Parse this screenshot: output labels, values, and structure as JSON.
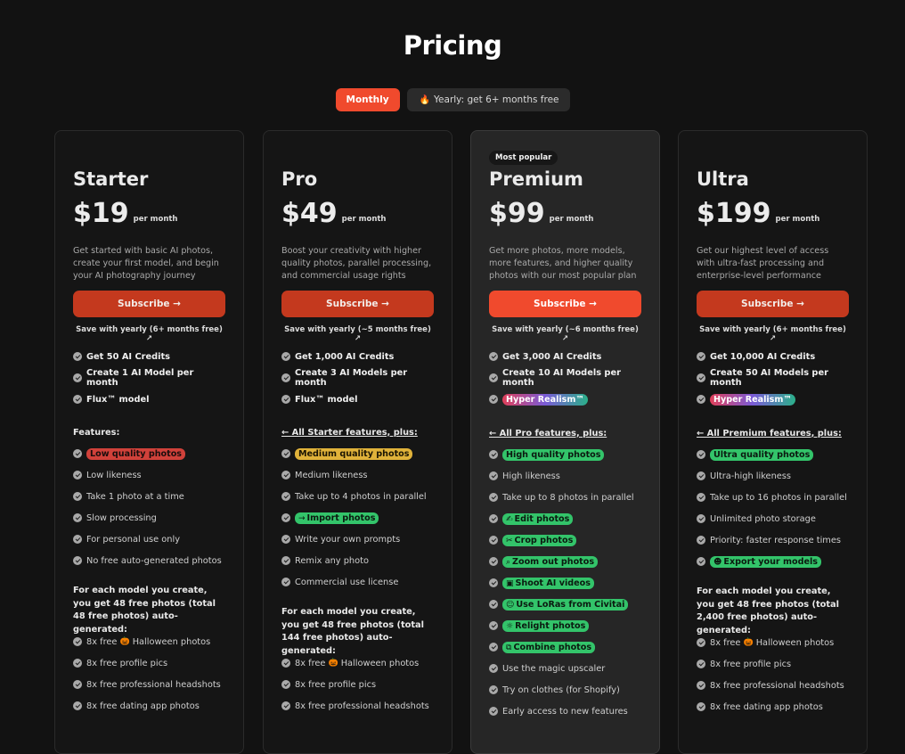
{
  "page": {
    "title": "Pricing",
    "toggle": {
      "monthly": "Monthly",
      "yearly_icon": "flame-icon",
      "yearly": "Yearly: get 6+ months free"
    }
  },
  "colors": {
    "accent": "#f04a2d",
    "accent_dark": "#c4391e",
    "background": "#121212",
    "pill_red": "#d0413a",
    "pill_yellow": "#e0b23a",
    "pill_green": "#33c46a"
  },
  "plans": [
    {
      "name": "Starter",
      "price": "$19",
      "period": "per month",
      "description": "Get started with basic AI photos, create your first model, and begin your AI photography journey",
      "cta": "Subscribe →",
      "save": "Save with yearly (6+ months free) ↗",
      "highlights": [
        "Get 50 AI Credits",
        "Create 1 AI Model per month",
        "Flux™ model"
      ],
      "features_title": "Features:",
      "features": [
        {
          "text": "Low quality photos",
          "pill": "red"
        },
        {
          "text": "Low likeness"
        },
        {
          "text": "Take 1 photo at a time"
        },
        {
          "text": "Slow processing"
        },
        {
          "text": "For personal use only"
        },
        {
          "text": "No free auto-generated photos"
        }
      ],
      "models_text": "For each model you create, you get 48 free photos (total 48 free photos) auto-generated:",
      "extras": [
        {
          "pre": "8x free",
          "icon": "pumpkin-icon",
          "post": "Halloween photos"
        },
        {
          "pre": "8x free profile pics"
        },
        {
          "pre": "8x free professional headshots"
        },
        {
          "pre": "8x free dating app photos"
        }
      ]
    },
    {
      "name": "Pro",
      "price": "$49",
      "period": "per month",
      "description": "Boost your creativity with higher quality photos, parallel processing, and commercial usage rights",
      "cta": "Subscribe →",
      "save": "Save with yearly (~5 months free) ↗",
      "highlights": [
        "Get 1,000 AI Credits",
        "Create 3 AI Models per month",
        "Flux™ model"
      ],
      "features_title": "← All Starter features, plus:",
      "features": [
        {
          "text": "Medium quality photos",
          "pill": "yellow"
        },
        {
          "text": "Medium likeness"
        },
        {
          "text": "Take up to 4 photos in parallel"
        },
        {
          "text": "Import photos",
          "pill": "green",
          "icon": "→"
        },
        {
          "text": "Write your own prompts"
        },
        {
          "text": "Remix any photo"
        },
        {
          "text": "Commercial use license"
        }
      ],
      "models_text": "For each model you create, you get 48 free photos (total 144 free photos) auto-generated:",
      "extras": [
        {
          "pre": "8x free",
          "icon": "pumpkin-icon",
          "post": "Halloween photos"
        },
        {
          "pre": "8x free profile pics"
        },
        {
          "pre": "8x free professional headshots"
        }
      ]
    },
    {
      "name": "Premium",
      "badge": "Most popular",
      "price": "$99",
      "period": "per month",
      "description": "Get more photos, more models, more features, and higher quality photos with our most popular plan",
      "cta": "Subscribe →",
      "save": "Save with yearly (~6 months free) ↗",
      "highlights": [
        "Get 3,000 AI Credits",
        "Create 10 AI Models per month"
      ],
      "hyper": "Hyper Realism™",
      "features_title": "← All Pro features, plus:",
      "features": [
        {
          "text": "High quality photos",
          "pill": "green"
        },
        {
          "text": "High likeness"
        },
        {
          "text": "Take up to 8 photos in parallel"
        },
        {
          "text": "Edit photos",
          "pill": "green",
          "icon": "✍"
        },
        {
          "text": "Crop photos",
          "pill": "green",
          "icon": "✂"
        },
        {
          "text": "Zoom out photos",
          "pill": "green",
          "icon": "⌕"
        },
        {
          "text": "Shoot AI videos",
          "pill": "green",
          "icon": "▣"
        },
        {
          "text": "Use LoRas from Civitai",
          "pill": "green",
          "icon": "☺"
        },
        {
          "text": "Relight photos",
          "pill": "green",
          "icon": "☼"
        },
        {
          "text": "Combine photos",
          "pill": "green",
          "icon": "⧉"
        },
        {
          "text": "Use the magic upscaler"
        },
        {
          "text": "Try on clothes (for Shopify)"
        },
        {
          "text": "Early access to new features"
        }
      ]
    },
    {
      "name": "Ultra",
      "price": "$199",
      "period": "per month",
      "description": "Get our highest level of access with ultra-fast processing and enterprise-level performance",
      "cta": "Subscribe →",
      "save": "Save with yearly (6+ months free) ↗",
      "highlights": [
        "Get 10,000 AI Credits",
        "Create 50 AI Models per month"
      ],
      "hyper": "Hyper Realism™",
      "features_title": "← All Premium features, plus:",
      "features": [
        {
          "text": "Ultra quality photos",
          "pill": "green"
        },
        {
          "text": "Ultra-high likeness"
        },
        {
          "text": "Take up to 16 photos in parallel"
        },
        {
          "text": "Unlimited photo storage"
        },
        {
          "text": "Priority: faster response times"
        },
        {
          "text": "Export your models",
          "pill": "green",
          "icon": "☻"
        }
      ],
      "models_text": "For each model you create, you get 48 free photos (total 2,400 free photos) auto-generated:",
      "extras": [
        {
          "pre": "8x free",
          "icon": "pumpkin-icon",
          "post": "Halloween photos"
        },
        {
          "pre": "8x free profile pics"
        },
        {
          "pre": "8x free professional headshots"
        },
        {
          "pre": "8x free dating app photos"
        }
      ]
    }
  ]
}
